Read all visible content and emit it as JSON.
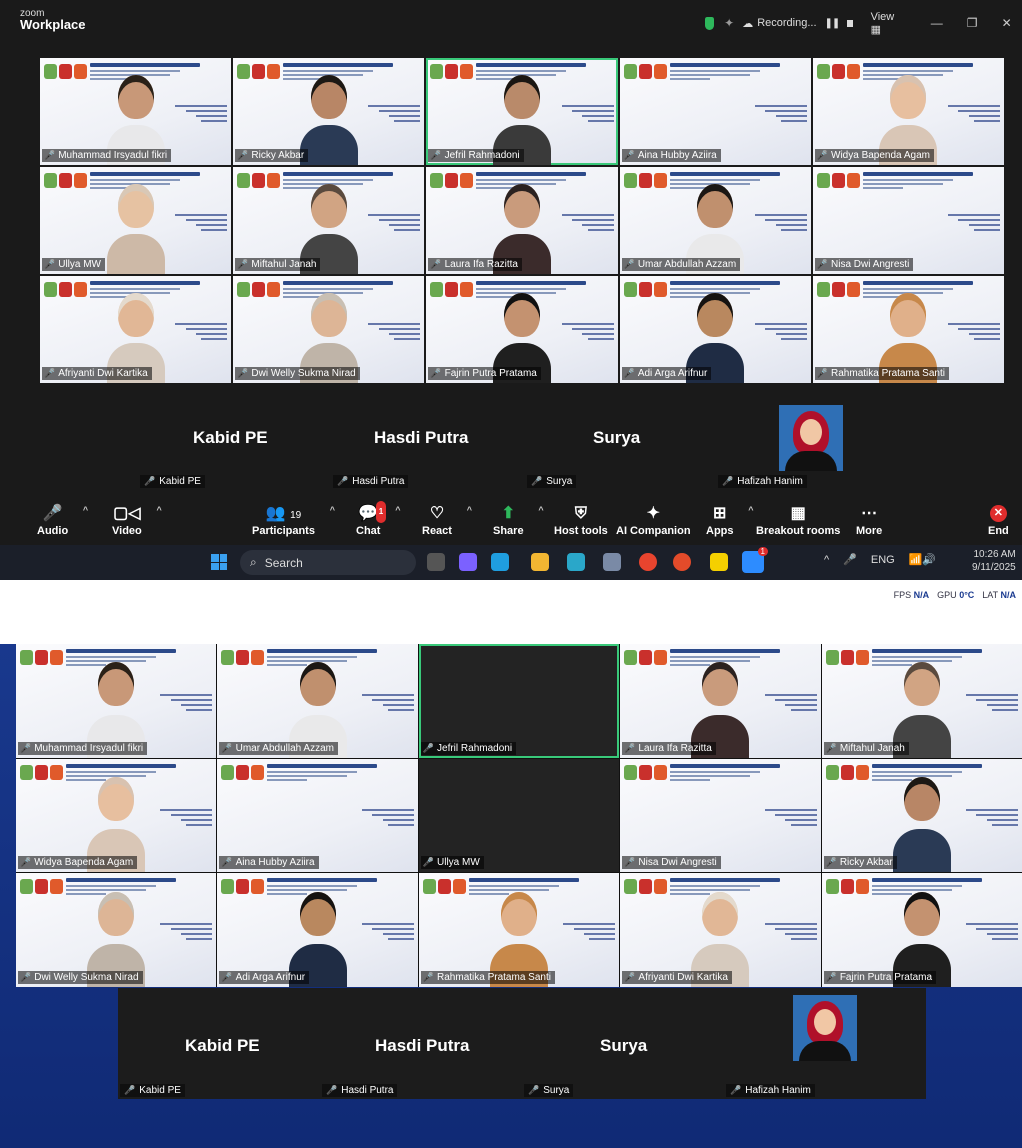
{
  "app": {
    "logo_top": "zoom",
    "logo_bottom": "Workplace"
  },
  "titlebar": {
    "recording": "Recording...",
    "view": "View",
    "pause": "❚❚",
    "minimize": "—",
    "restore": "❐",
    "close": "✕"
  },
  "grid1": [
    {
      "name": "Muhammad Irsyadul fikri",
      "type": "person",
      "hair": "#2a2118",
      "skin": "#c89878",
      "shirt": "#e8e8ea"
    },
    {
      "name": "Ricky Akbar",
      "type": "person",
      "hair": "#1c1814",
      "skin": "#b88666",
      "shirt": "#2a3a55"
    },
    {
      "name": "Jefril Rahmadoni",
      "type": "person",
      "hair": "#1a1612",
      "skin": "#b98a6a",
      "shirt": "#3a3a3a",
      "active": true
    },
    {
      "name": "Aina Hubby Aziira",
      "type": "slide"
    },
    {
      "name": "Widya Bapenda Agam",
      "type": "person",
      "hair": "#d8c2b0",
      "skin": "#e7bf9f",
      "shirt": "#d9c6b6"
    },
    {
      "name": "Ullya MW",
      "type": "person",
      "hair": "#d9c8b6",
      "skin": "#e6c2a2",
      "shirt": "#cdb9a7"
    },
    {
      "name": "Miftahul Janah",
      "type": "person",
      "hair": "#5a4a3e",
      "skin": "#d1a483",
      "shirt": "#444"
    },
    {
      "name": "Laura Ifa Razitta",
      "type": "person",
      "hair": "#2b2220",
      "skin": "#c99b7c",
      "shirt": "#3b2b2b"
    },
    {
      "name": "Umar Abdullah Azzam",
      "type": "person",
      "hair": "#1b1714",
      "skin": "#c0906e",
      "shirt": "#e9e9ea"
    },
    {
      "name": "Nisa Dwi Angresti",
      "type": "slide"
    },
    {
      "name": "Afriyanti Dwi Kartika",
      "type": "person",
      "hair": "#e4dacd",
      "skin": "#e1b796",
      "shirt": "#d6cabe"
    },
    {
      "name": "Dwi Welly Sukma Nirad",
      "type": "person",
      "hair": "#c8bfb3",
      "skin": "#ddb596",
      "shirt": "#bfb4a8"
    },
    {
      "name": "Fajrin Putra Pratama",
      "type": "person",
      "hair": "#111",
      "skin": "#c49270",
      "shirt": "#1f1f1f"
    },
    {
      "name": "Adi Arga Arifnur",
      "type": "person",
      "hair": "#161311",
      "skin": "#b9885f",
      "shirt": "#1f2c44"
    },
    {
      "name": "Rahmatika Pratama Santi",
      "type": "person",
      "hair": "#c7884a",
      "skin": "#e0b08a",
      "shirt": "#c7884a"
    }
  ],
  "strip1": [
    {
      "big": "Kabid PE",
      "label": "Kabid PE"
    },
    {
      "big": "Hasdi Putra",
      "label": "Hasdi Putra"
    },
    {
      "big": "Surya",
      "label": "Surya"
    },
    {
      "big": "",
      "label": "Hafizah Hanim",
      "photo": true
    }
  ],
  "toolbar": {
    "audio": "Audio",
    "video": "Video",
    "participants": "Participants",
    "participants_count": "19",
    "chat": "Chat",
    "chat_badge": "1",
    "react": "React",
    "share": "Share",
    "host_tools": "Host tools",
    "ai_companion": "AI Companion",
    "apps": "Apps",
    "breakout_rooms": "Breakout rooms",
    "more": "More",
    "end": "End"
  },
  "taskbar": {
    "search": "Search",
    "lang": "ENG",
    "time": "10:26 AM",
    "date": "9/11/2025",
    "app_badge": "1"
  },
  "stats": {
    "fps_label": "FPS",
    "fps_value": "N/A",
    "gpu_label": "GPU",
    "gpu_value": "0°C",
    "lat_label": "LAT",
    "lat_value": "N/A"
  },
  "grid2": [
    {
      "name": "Muhammad Irsyadul fikri",
      "type": "person",
      "hair": "#2a2118",
      "skin": "#c89878",
      "shirt": "#e8e8ea"
    },
    {
      "name": "Umar Abdullah Azzam",
      "type": "person",
      "hair": "#1b1714",
      "skin": "#c0906e",
      "shirt": "#e9e9ea"
    },
    {
      "name": "Jefril Rahmadoni",
      "type": "dark",
      "active": true
    },
    {
      "name": "Laura Ifa Razitta",
      "type": "person",
      "hair": "#2b2220",
      "skin": "#c99b7c",
      "shirt": "#3b2b2b"
    },
    {
      "name": "Miftahul Janah",
      "type": "person",
      "hair": "#5a4a3e",
      "skin": "#d1a483",
      "shirt": "#444"
    },
    {
      "name": "Widya Bapenda Agam",
      "type": "person",
      "hair": "#d8c2b0",
      "skin": "#e7bf9f",
      "shirt": "#d9c6b6"
    },
    {
      "name": "Aina Hubby Aziira",
      "type": "slide"
    },
    {
      "name": "Ullya MW",
      "type": "dark"
    },
    {
      "name": "Nisa Dwi Angresti",
      "type": "slide"
    },
    {
      "name": "Ricky Akbar",
      "type": "person",
      "hair": "#1c1814",
      "skin": "#b88666",
      "shirt": "#2a3a55"
    },
    {
      "name": "Dwi Welly Sukma Nirad",
      "type": "person",
      "hair": "#c8bfb3",
      "skin": "#ddb596",
      "shirt": "#bfb4a8"
    },
    {
      "name": "Adi Arga Arifnur",
      "type": "person",
      "hair": "#161311",
      "skin": "#b9885f",
      "shirt": "#1f2c44"
    },
    {
      "name": "Rahmatika Pratama Santi",
      "type": "person",
      "hair": "#c7884a",
      "skin": "#e0b08a",
      "shirt": "#c7884a"
    },
    {
      "name": "Afriyanti Dwi Kartika",
      "type": "person",
      "hair": "#e4dacd",
      "skin": "#e1b796",
      "shirt": "#d6cabe"
    },
    {
      "name": "Fajrin Putra Pratama",
      "type": "person",
      "hair": "#111",
      "skin": "#c49270",
      "shirt": "#1f1f1f"
    }
  ],
  "strip2": [
    {
      "big": "Kabid PE",
      "label": "Kabid PE"
    },
    {
      "big": "Hasdi Putra",
      "label": "Hasdi Putra"
    },
    {
      "big": "Surya",
      "label": "Surya"
    },
    {
      "big": "",
      "label": "Hafizah Hanim",
      "photo": true
    }
  ],
  "colors": {
    "accent_green": "#39c97a",
    "end_red": "#e02d2d",
    "mic_muted": "#ff5a5a"
  }
}
